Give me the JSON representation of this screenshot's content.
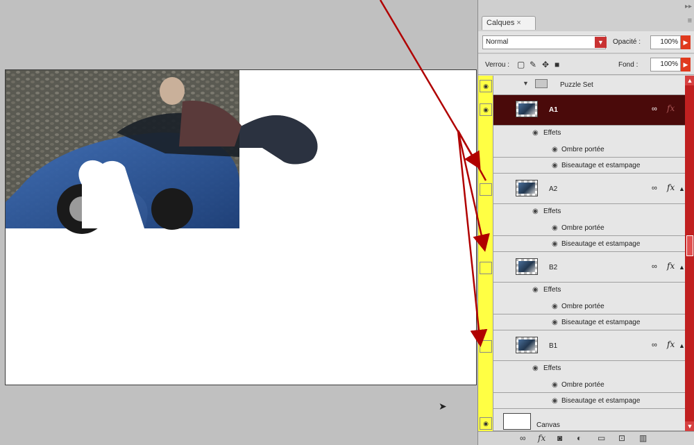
{
  "panel": {
    "tab_label": "Calques",
    "tab_close": "×",
    "blend_mode": "Normal",
    "opacity_label": "Opacité :",
    "opacity_value": "100%",
    "lock_label": "Verrou :",
    "fill_label": "Fond :",
    "fill_value": "100%"
  },
  "layers": {
    "group_name": "Puzzle Set",
    "items": [
      {
        "name": "A1",
        "effects_label": "Effets",
        "effect1": "Ombre portée",
        "effect2": "Biseautage et estampage"
      },
      {
        "name": "A2",
        "effects_label": "Effets",
        "effect1": "Ombre portée",
        "effect2": "Biseautage et estampage"
      },
      {
        "name": "B2",
        "effects_label": "Effets",
        "effect1": "Ombre portée",
        "effect2": "Biseautage et estampage"
      },
      {
        "name": "B1",
        "effects_label": "Effets",
        "effect1": "Ombre portée",
        "effect2": "Biseautage et estampage"
      }
    ],
    "background_name": "Canvas"
  },
  "icons": {
    "eye": "eye-icon",
    "link": "link-icon",
    "fx": "fx",
    "tab_menu": "≡",
    "collapse": "▸▸"
  },
  "colors": {
    "visibility_column": "#ffff44",
    "selected_layer": "#4a0a0a",
    "accent_red": "#c02020",
    "annotation_arrow": "#b00000"
  }
}
